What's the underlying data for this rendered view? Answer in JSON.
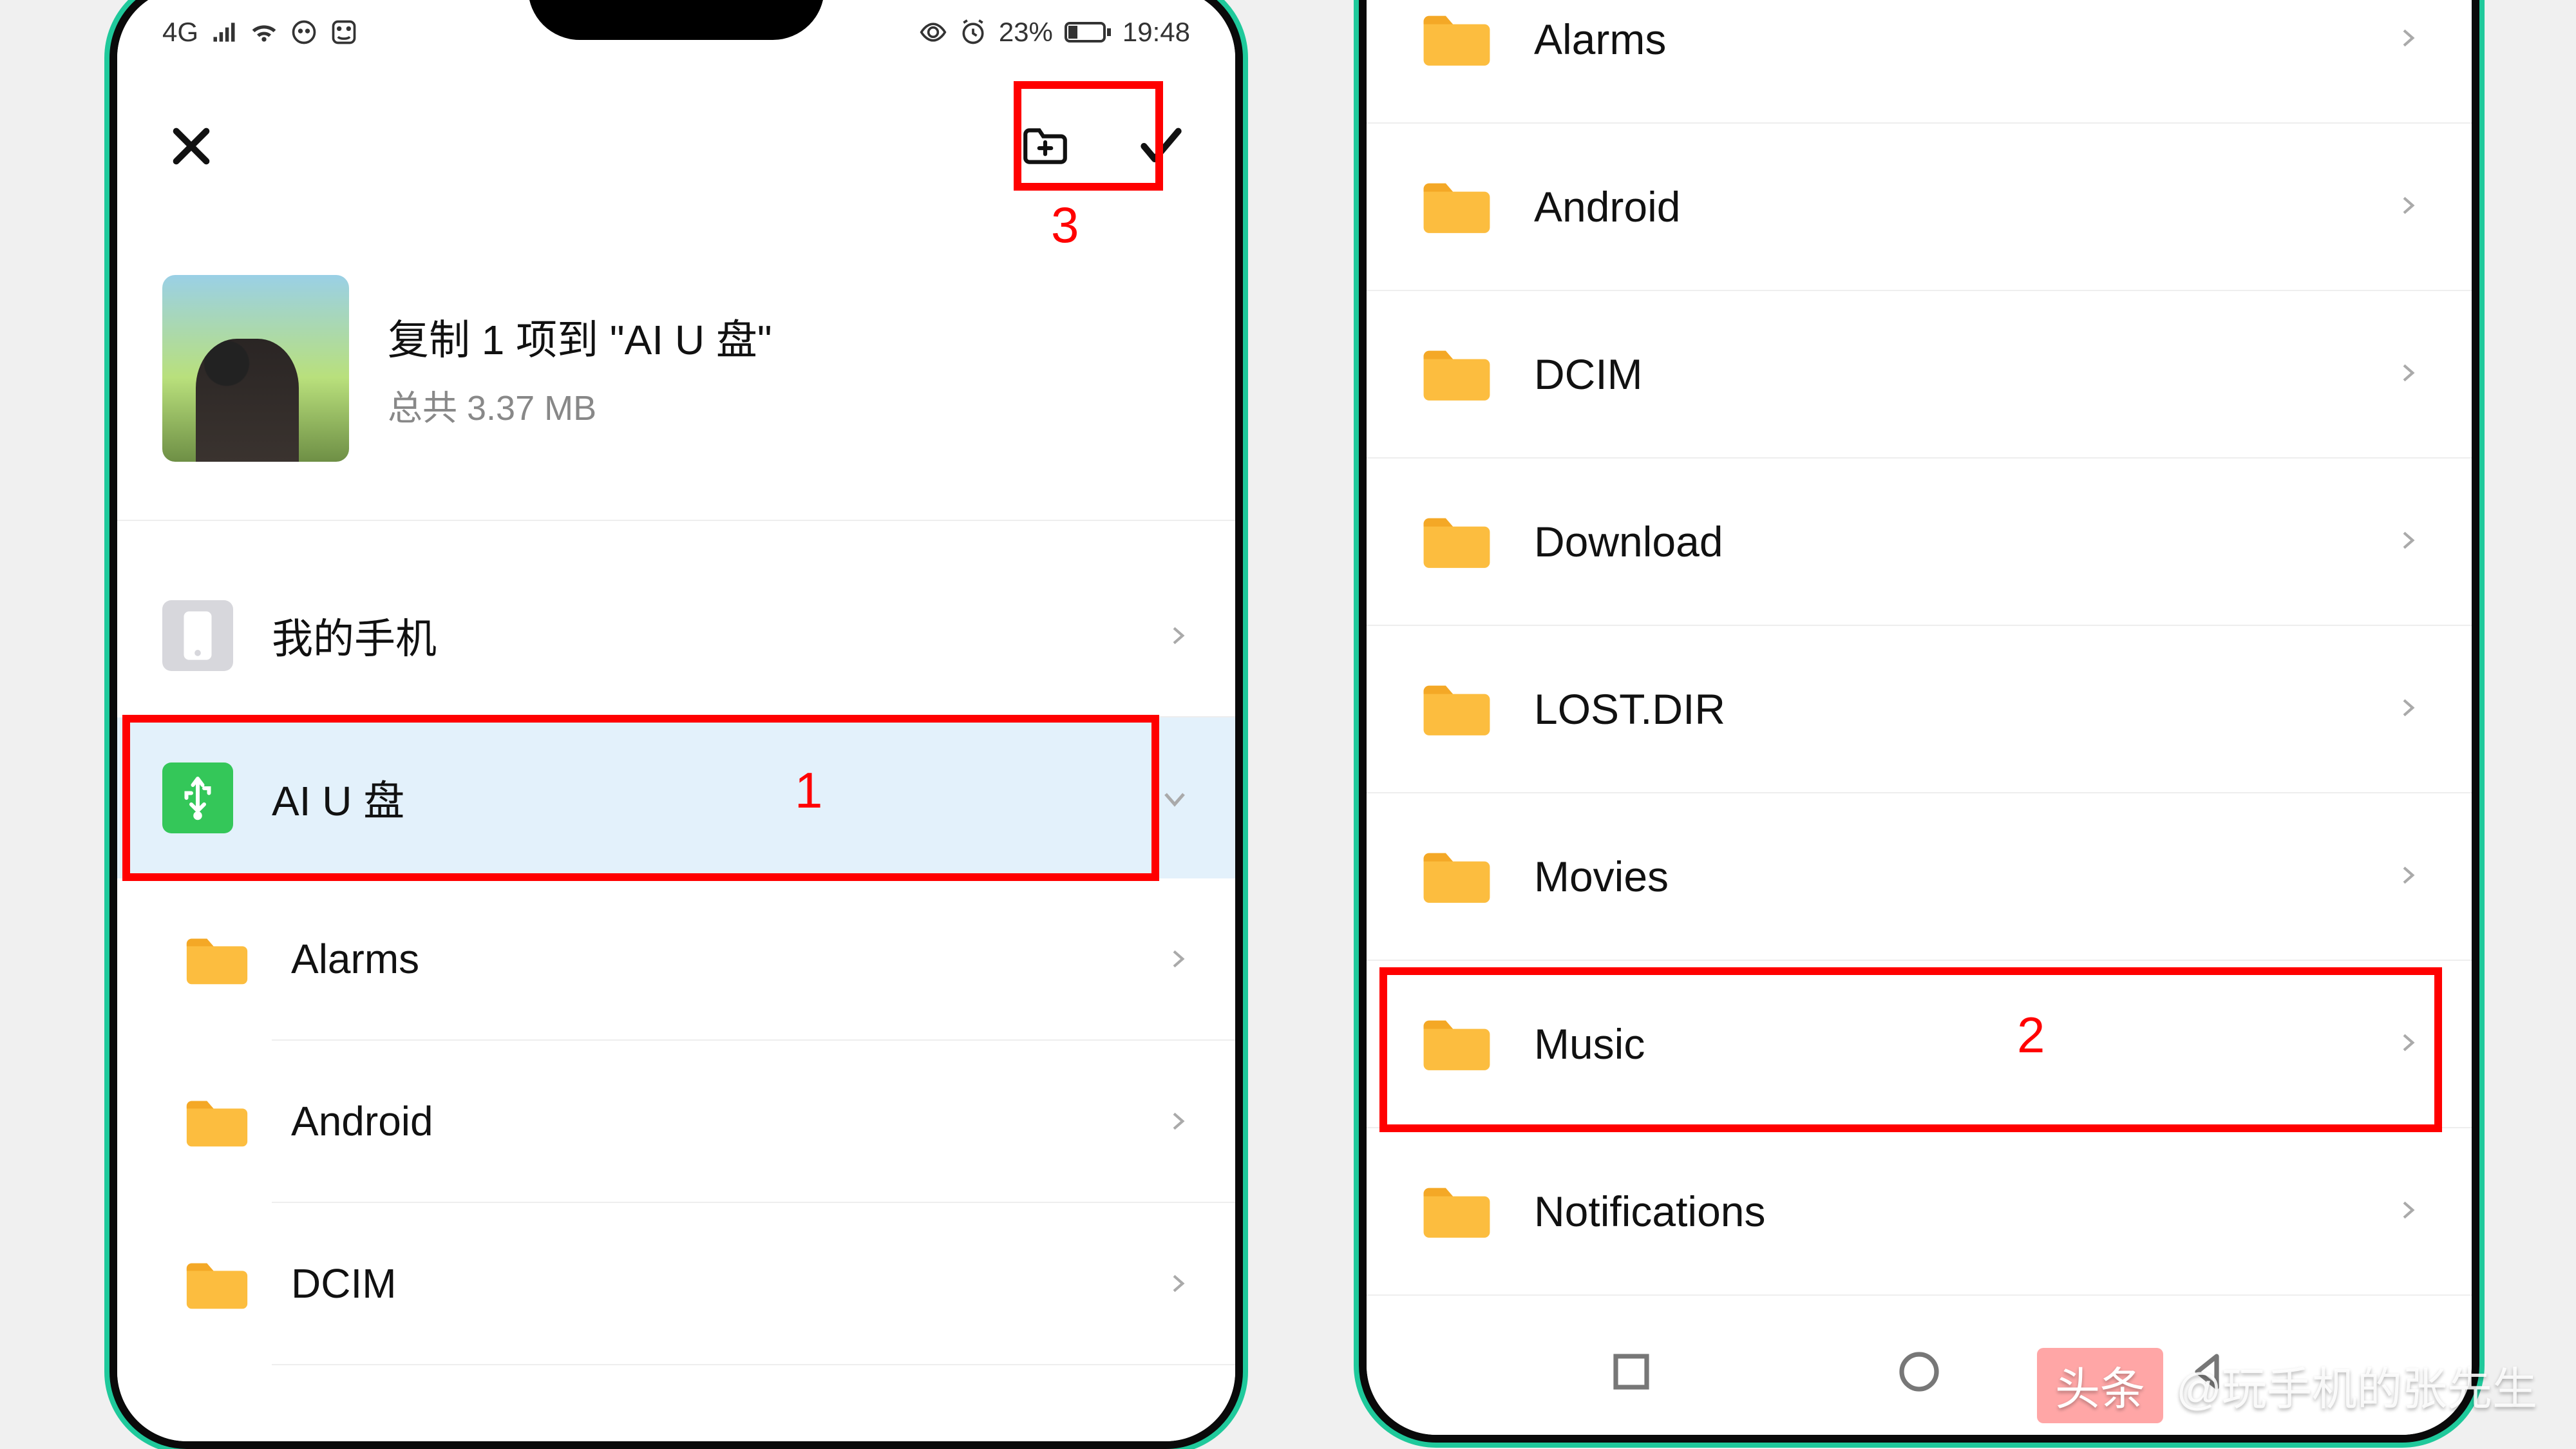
{
  "statusbar": {
    "signal_label": "4G",
    "battery_text": "23%",
    "time": "19:48"
  },
  "actionbar": {},
  "clipboard": {
    "title": "复制 1 项到 \"AI U 盘\"",
    "subtitle": "总共 3.37 MB"
  },
  "locations": {
    "phone": "我的手机",
    "usb": "AI U 盘"
  },
  "left_folders": [
    {
      "name": "Alarms"
    },
    {
      "name": "Android"
    },
    {
      "name": "DCIM"
    }
  ],
  "right_folders": [
    {
      "name": "Alarms"
    },
    {
      "name": "Android"
    },
    {
      "name": "DCIM"
    },
    {
      "name": "Download"
    },
    {
      "name": "LOST.DIR"
    },
    {
      "name": "Movies"
    },
    {
      "name": "Music"
    },
    {
      "name": "Notifications"
    }
  ],
  "annotations": {
    "one": "1",
    "two": "2",
    "three": "3"
  },
  "watermark": {
    "source": "头条",
    "handle": "@玩手机的张先生"
  }
}
